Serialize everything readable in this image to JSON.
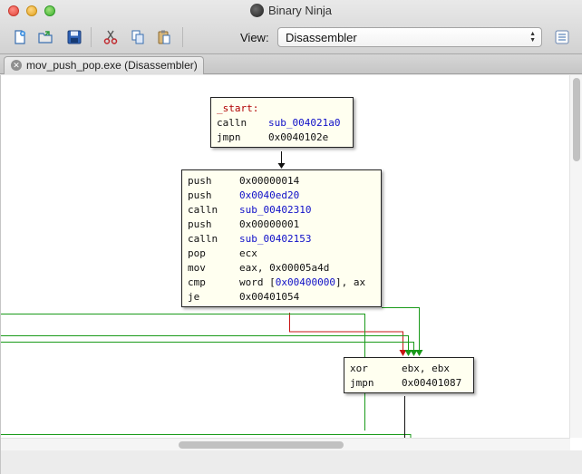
{
  "window": {
    "title": "Binary Ninja"
  },
  "toolbar": {
    "buttons": [
      {
        "name": "new-file-icon"
      },
      {
        "name": "open-file-icon"
      },
      {
        "name": "save-icon"
      },
      {
        "name": "cut-icon"
      },
      {
        "name": "copy-icon"
      },
      {
        "name": "paste-icon"
      }
    ],
    "view_label": "View:",
    "view_value": "Disassembler"
  },
  "tabs": [
    {
      "label": "mov_push_pop.exe (Disassembler)"
    }
  ],
  "graph": {
    "blocks": [
      {
        "label": "_start:",
        "lines": [
          {
            "mnemonic": "calln",
            "pre": "",
            "ref": "sub_004021a0",
            "post": ""
          },
          {
            "mnemonic": "jmpn",
            "pre": "0x0040102e",
            "ref": "",
            "post": ""
          }
        ]
      },
      {
        "lines": [
          {
            "mnemonic": "push",
            "pre": "0x00000014",
            "ref": "",
            "post": ""
          },
          {
            "mnemonic": "push",
            "pre": "",
            "ref": "0x0040ed20",
            "post": ""
          },
          {
            "mnemonic": "calln",
            "pre": "",
            "ref": "sub_00402310",
            "post": ""
          },
          {
            "mnemonic": "push",
            "pre": "0x00000001",
            "ref": "",
            "post": ""
          },
          {
            "mnemonic": "calln",
            "pre": "",
            "ref": "sub_00402153",
            "post": ""
          },
          {
            "mnemonic": "pop",
            "pre": "ecx",
            "ref": "",
            "post": ""
          },
          {
            "mnemonic": "mov",
            "pre": "eax, 0x00005a4d",
            "ref": "",
            "post": ""
          },
          {
            "mnemonic": "cmp",
            "pre": "word [",
            "ref": "0x00400000",
            "post": "], ax"
          },
          {
            "mnemonic": "je",
            "pre": "0x00401054",
            "ref": "",
            "post": ""
          }
        ]
      },
      {
        "lines": [
          {
            "mnemonic": "xor",
            "pre": "ebx, ebx",
            "ref": "",
            "post": ""
          },
          {
            "mnemonic": "jmpn",
            "pre": "0x00401087",
            "ref": "",
            "post": ""
          }
        ]
      }
    ],
    "colors": {
      "true_edge": "#1a9a1a",
      "false_edge": "#c81414",
      "unconditional_edge": "#111111",
      "label": "#b00000",
      "reference": "#1010c8",
      "block_bg": "#fffff0"
    }
  }
}
